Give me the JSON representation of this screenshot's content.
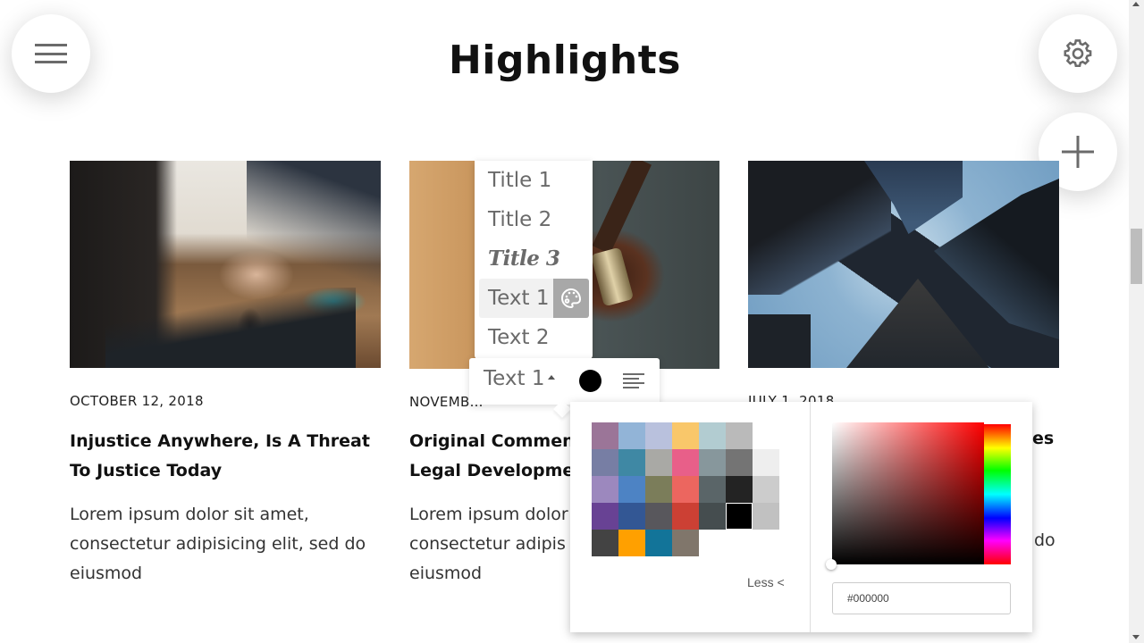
{
  "header": {
    "title": "Highlights",
    "menu_icon": "hamburger-icon",
    "settings_icon": "gear-icon",
    "add_icon": "plus-icon"
  },
  "cards": [
    {
      "date": "OCTOBER 12, 2018",
      "title": "Injustice Anywhere, Is A Threat To Justice Today",
      "body": "Lorem ipsum dolor sit amet, consectetur adipisicing elit, sed do eiusmod",
      "image": "business-handshake-photo"
    },
    {
      "date": "NOVEMB…",
      "title": "Original Comment… Legal Developmen…",
      "title_line1": "Original Comment",
      "title_line2": "Legal Developmen",
      "body_line1": "Lorem ipsum dolor",
      "body_line2": "consectetur adipis",
      "body_line3": "eiusmod",
      "image": "gavel-photo"
    },
    {
      "date": "JULY 1, 2018",
      "title_tail": "es",
      "body_tail": "do",
      "image": "skyscrapers-photo"
    }
  ],
  "style_menu": {
    "items": [
      {
        "label": "Title 1"
      },
      {
        "label": "Title 2"
      },
      {
        "label": "Title 3"
      },
      {
        "label": "Text 1",
        "active": true
      },
      {
        "label": "Text 2"
      }
    ],
    "palette_icon": "palette-icon"
  },
  "toolbar": {
    "style_label": "Text 1",
    "color": "#000000",
    "align_icon": "align-left-icon"
  },
  "color_picker": {
    "swatches": [
      [
        "#9b7598",
        "#92b4d7",
        "#b9c1dd",
        "#f9c76a",
        "#b2ccd1",
        "#bababa",
        null
      ],
      [
        "#777ea4",
        "#3f88a4",
        "#a9a9a5",
        "#e85f89",
        "#87979c",
        "#747474",
        "#eeeeee"
      ],
      [
        "#9c88be",
        "#4d83c4",
        "#7b7d5a",
        "#ec665f",
        "#5a6568",
        "#232323",
        "#cccccc"
      ],
      [
        "#684294",
        "#335794",
        "#58575c",
        "#cc4034",
        "#454d4f",
        "#000000",
        "#c1c1c1"
      ],
      [
        "#434343",
        "#ffa000",
        "#127499",
        "#80766b",
        null,
        null,
        null
      ]
    ],
    "selected": "#000000",
    "less_label": "Less <",
    "hex_value": "#000000",
    "hue": "#ff0000"
  }
}
